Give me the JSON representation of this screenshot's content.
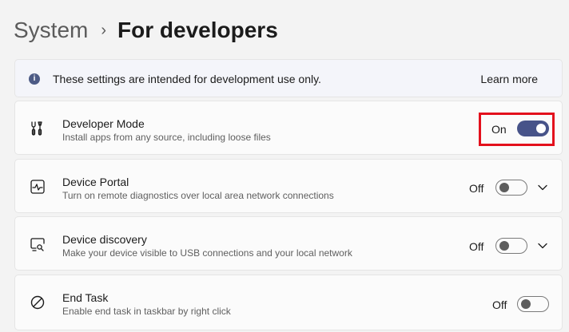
{
  "breadcrumb": {
    "parent": "System",
    "separator": "›",
    "current": "For developers"
  },
  "info_banner": {
    "icon": "info-icon",
    "text": "These settings are intended for development use only.",
    "link": "Learn more"
  },
  "settings": [
    {
      "icon": "developer-tools-icon",
      "title": "Developer Mode",
      "description": "Install apps from any source, including loose files",
      "state_label": "On",
      "toggle_on": true,
      "expandable": false
    },
    {
      "icon": "device-portal-icon",
      "title": "Device Portal",
      "description": "Turn on remote diagnostics over local area network connections",
      "state_label": "Off",
      "toggle_on": false,
      "expandable": true
    },
    {
      "icon": "device-discovery-icon",
      "title": "Device discovery",
      "description": "Make your device visible to USB connections and your local network",
      "state_label": "Off",
      "toggle_on": false,
      "expandable": true
    },
    {
      "icon": "end-task-icon",
      "title": "End Task",
      "description": "Enable end task in taskbar by right click",
      "state_label": "Off",
      "toggle_on": false,
      "expandable": false
    }
  ],
  "colors": {
    "accent": "#475389",
    "highlight": "#e3101c"
  }
}
